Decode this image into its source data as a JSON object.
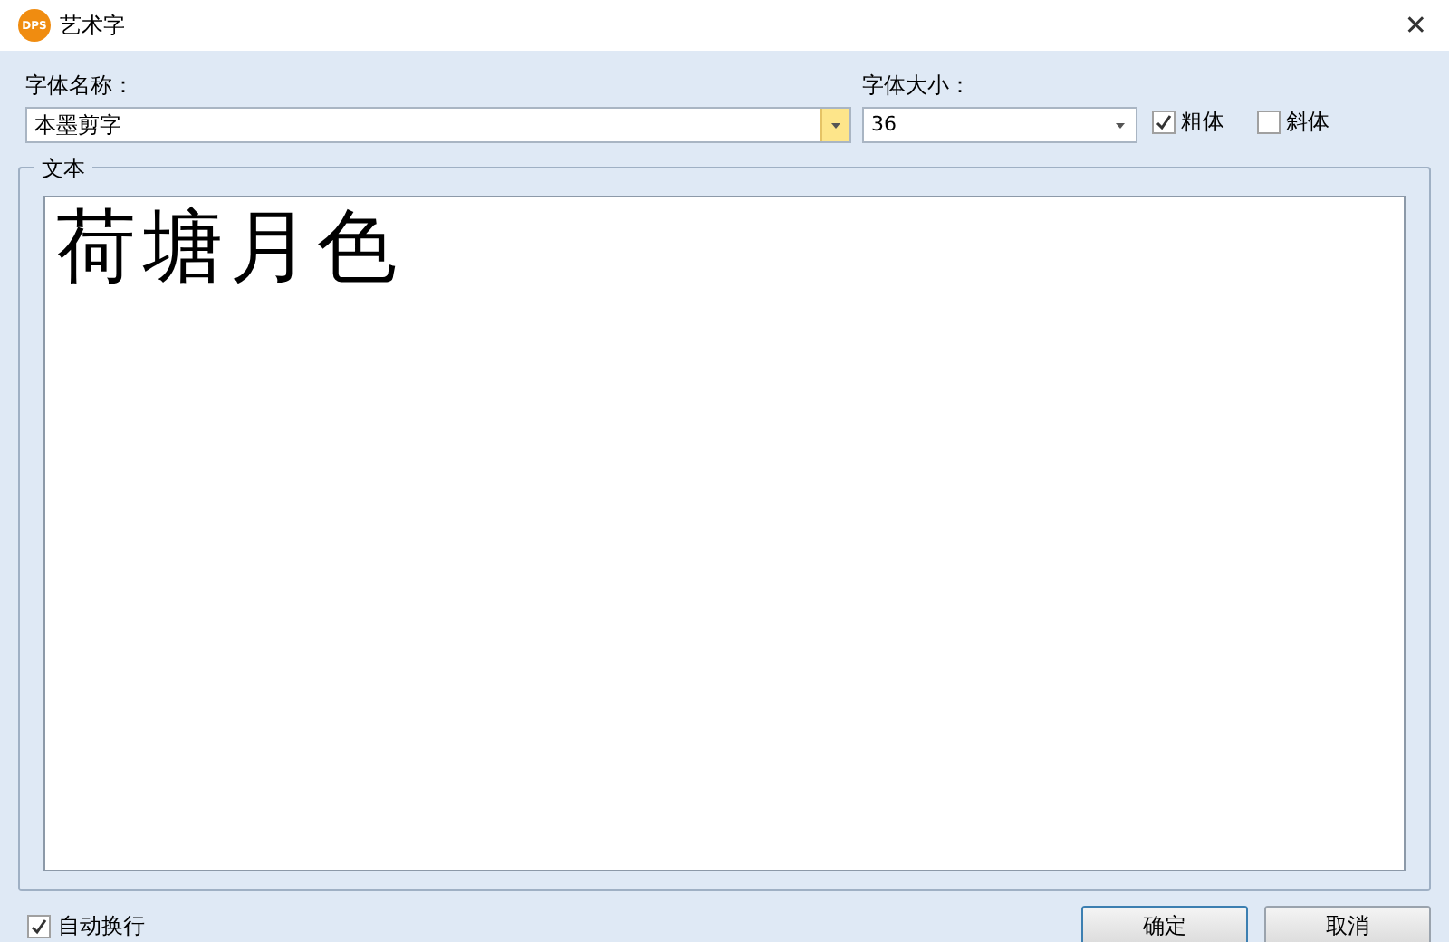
{
  "window": {
    "logo": "DPS",
    "title": "艺术字",
    "close": "✕"
  },
  "font_name": {
    "label": "字体名称：",
    "value": "本墨剪字"
  },
  "font_size": {
    "label": "字体大小：",
    "value": "36"
  },
  "options": [
    {
      "label": "粗体",
      "checked": true
    },
    {
      "label": "斜体",
      "checked": false
    }
  ],
  "text_group": {
    "label": "文本",
    "value": "荷塘月色"
  },
  "word_wrap": {
    "label": "自动换行",
    "checked": true
  },
  "buttons": [
    "确定",
    "取消"
  ]
}
